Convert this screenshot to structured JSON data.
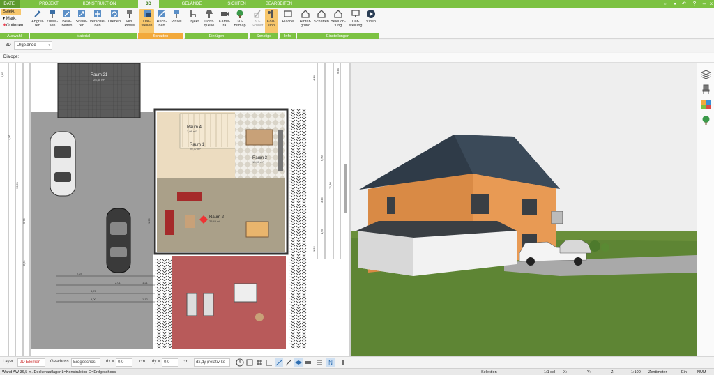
{
  "tabs": [
    "DATEI",
    "PROJEKT",
    "KONSTRUKTION",
    "3D",
    "GELÄNDE",
    "SICHTEN",
    "BEARBEITEN"
  ],
  "ribbon": {
    "auswahl": {
      "selekt": "Selekt",
      "mark": "Mark.",
      "optionen": "Optionen",
      "group": "Auswahl"
    },
    "material": {
      "buttons": [
        "Abgrei-\nfen",
        "Zuwei-\nsen",
        "Bear-\nbeiten",
        "Skalie-\nren",
        "Verschie-\nben",
        "Drehen",
        "Hin.\nPinsel"
      ],
      "group": "Material"
    },
    "schatten": {
      "buttons": [
        "Dar-\nstellen",
        "Rech-\nnen",
        "Pinsel"
      ],
      "group": "Schatten"
    },
    "einfuegen": {
      "buttons": [
        "Objekt",
        "Licht-\nquelle",
        "Kame-\nra",
        "3D-\nBitmap"
      ],
      "group": "Einfügen"
    },
    "sonstige": {
      "buttons": [
        "3D-\nSchnitt",
        "Kolli-\nsion"
      ],
      "group": "Sonstige"
    },
    "info": {
      "buttons": [
        "Fläche"
      ],
      "group": "Info"
    },
    "einstellungen": {
      "buttons": [
        "Hinter-\ngrund",
        "Schatten",
        "Beleuch-\ntung",
        "Dar-\nstellung",
        "Video"
      ],
      "group": "Einstellungen"
    }
  },
  "view_bar": {
    "label": "3D",
    "select": "Urgelände"
  },
  "dialog_bar": {
    "label": "Dialoge:"
  },
  "plan": {
    "rooms": [
      {
        "name": "Raum 21",
        "area": "25,40 m²"
      },
      {
        "name": "Raum 4",
        "area": "2,08 m²"
      },
      {
        "name": "Raum 1",
        "area": "20,77 m²"
      },
      {
        "name": "Raum 3",
        "area": "15,50 m²"
      },
      {
        "name": "Raum 2",
        "area": "25,45 m²"
      }
    ],
    "dims_left": [
      "5,49",
      "4,99",
      "10,61",
      "5,76",
      "1,26",
      "2,51"
    ],
    "dims_bottom": [
      "2,24",
      "2,01",
      "3,76",
      "9,00",
      "1,21",
      "1,12"
    ],
    "dims_right": [
      "4,14",
      "6,99",
      "11,30",
      "3,45",
      "1,65",
      "1,26",
      "9,44"
    ]
  },
  "bottom": {
    "layer_label": "Layer",
    "layer_value": "2D-Elemen",
    "geschoss_label": "Geschoss",
    "geschoss_value": "Erdgeschos",
    "dx_label": "dx =",
    "dx_value": "0,0",
    "dx_unit": "cm",
    "dy_label": "dy =",
    "dy_value": "0,0",
    "dy_unit": "cm",
    "mode_value": "dx,dy (relativ ke"
  },
  "status": {
    "left": "Wand AW 36,5 m. Deckenauflager L=Konstruktion G=Erdgeschoss",
    "selektion": "Selektion",
    "sel_count": "1:1 sel",
    "x": "X:",
    "y": "Y:",
    "z": "Z:",
    "scale": "1:100",
    "unit": "Zentimeter",
    "ein": "Ein",
    "num": "NUM"
  },
  "colors": {
    "accent": "#7cc242",
    "highlight": "#f7c66b",
    "roof": "#2f3b48",
    "wall": "#e89a54"
  }
}
